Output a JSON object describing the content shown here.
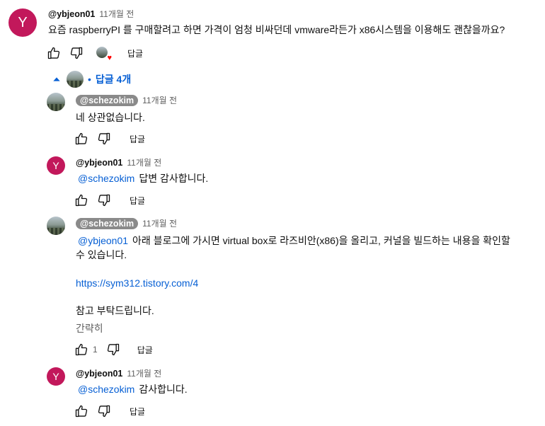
{
  "main_comment": {
    "avatar_letter": "Y",
    "author": "@ybjeon01",
    "time": "11개월 전",
    "text": "요즘 raspberryPI 를 구매할려고 하면 가격이 엄청 비싸던데 vmware라든가 x86시스템을 이용해도 괜찮을까요?",
    "reply_label": "답글",
    "creator_heart_icon": "heart-icon"
  },
  "replies_toggle": {
    "label": "답글 4개",
    "bullet": "•"
  },
  "replies": [
    {
      "author": "@schezokim",
      "time": "11개월 전",
      "text": "네 상관없습니다.",
      "reply_label": "답글"
    },
    {
      "avatar_letter": "Y",
      "author": "@ybjeon01",
      "time": "11개월 전",
      "mention": "@schezokim",
      "text": "답변 감사합니다.",
      "reply_label": "답글"
    },
    {
      "author": "@schezokim",
      "time": "11개월 전",
      "mention": "@ybjeon01",
      "text_line1": "아래 블로그에 가시면 virtual box로 라즈비안(x86)을 올리고, 커널을 빌드하는 내용을 확인할",
      "text_line2": "수 있습니다.",
      "link": "https://sym312.tistory.com/4",
      "text_closing": "참고 부탁드립니다.",
      "read_less": "간략히",
      "like_count": "1",
      "reply_label": "답글"
    },
    {
      "avatar_letter": "Y",
      "author": "@ybjeon01",
      "time": "11개월 전",
      "mention": "@schezokim",
      "text": "감사합니다.",
      "reply_label": "답글"
    }
  ],
  "colors": {
    "link": "#065fd4",
    "avatar_y": "#c2185b",
    "heart": "#ff0000"
  }
}
